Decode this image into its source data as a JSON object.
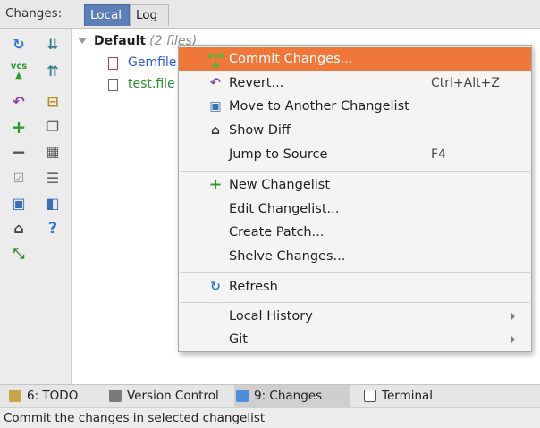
{
  "tabs": {
    "caption": "Changes:",
    "items": [
      "Local",
      "Log"
    ]
  },
  "tree": {
    "root_name": "Default",
    "root_count": "(2 files)",
    "files": [
      "Gemfile",
      "test.file"
    ]
  },
  "menu": {
    "items": [
      {
        "label": "Commit Changes...",
        "icon": "vcs-commit-icon",
        "shortcut": ""
      },
      {
        "label": "Revert...",
        "icon": "revert-icon",
        "shortcut": "Ctrl+Alt+Z"
      },
      {
        "label": "Move to Another Changelist",
        "icon": "move-changelist-icon",
        "shortcut": ""
      },
      {
        "label": "Show Diff",
        "icon": "show-diff-icon",
        "shortcut": ""
      },
      {
        "label": "Jump to Source",
        "icon": "",
        "shortcut": "F4"
      },
      {
        "label": "New Changelist",
        "icon": "plus-icon",
        "shortcut": ""
      },
      {
        "label": "Edit Changelist...",
        "icon": "",
        "shortcut": ""
      },
      {
        "label": "Create Patch...",
        "icon": "",
        "shortcut": ""
      },
      {
        "label": "Shelve Changes...",
        "icon": "",
        "shortcut": ""
      },
      {
        "label": "Refresh",
        "icon": "refresh-icon",
        "shortcut": ""
      },
      {
        "label": "Local History",
        "icon": "",
        "shortcut": ""
      },
      {
        "label": "Git",
        "icon": "",
        "shortcut": ""
      }
    ]
  },
  "bottombar": {
    "items": [
      "6: TODO",
      "Version Control",
      "9: Changes",
      "Terminal"
    ]
  },
  "status": {
    "text": "Commit the changes in selected changelist"
  },
  "colors": {
    "highlight": "#f0773a",
    "tab_active": "#5d7fb8",
    "file_modified": "#2a5bd7",
    "file_added": "#2e8b2e"
  }
}
